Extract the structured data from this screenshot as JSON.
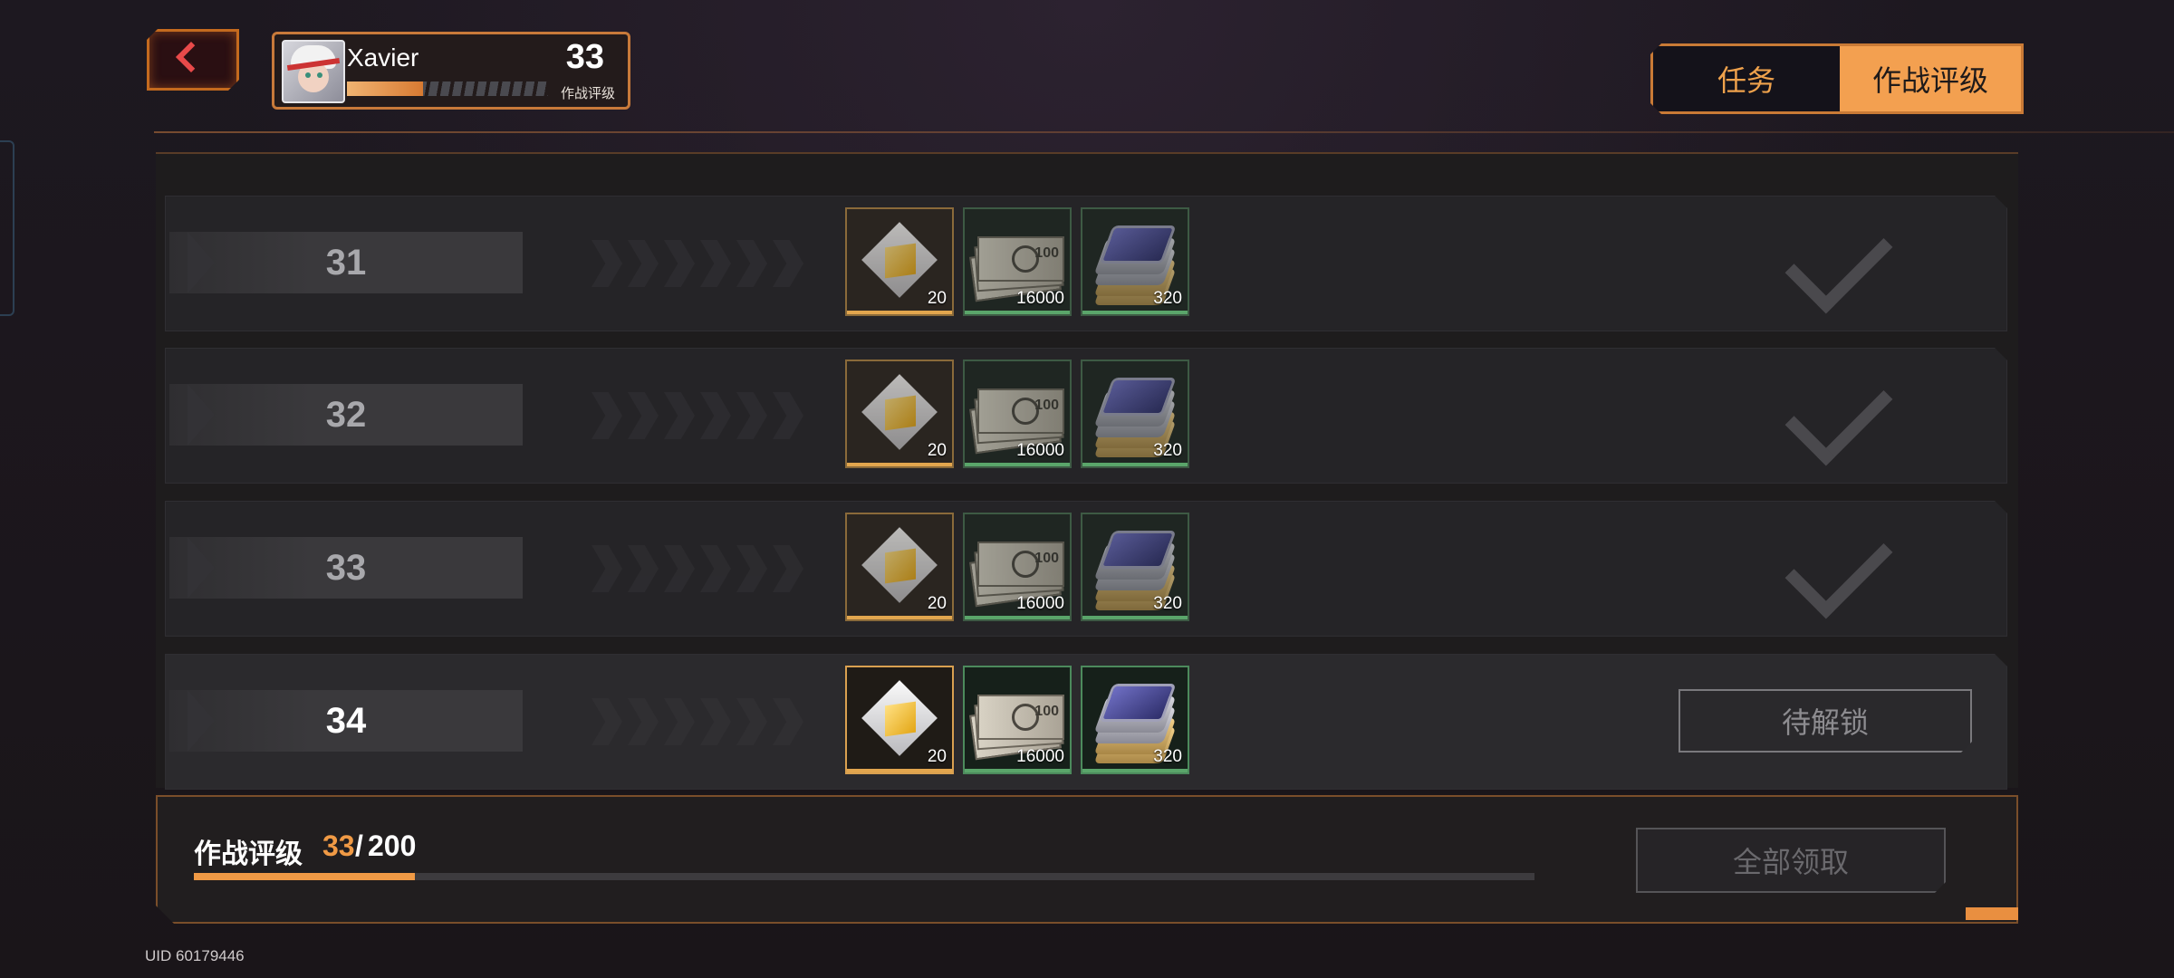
{
  "player": {
    "name": "Xavier",
    "level": "33",
    "level_label": "作战评级",
    "level_progress": 0.38
  },
  "tabs": {
    "task": "任务",
    "rank": "作战评级",
    "active": "rank"
  },
  "rows": [
    {
      "level": "31",
      "rewards": [
        {
          "icon": "cube-crystal-icon",
          "qty": "20"
        },
        {
          "icon": "banknotes-icon",
          "qty": "16000"
        },
        {
          "icon": "chip-stack-icon",
          "qty": "320"
        }
      ],
      "status": "claimed"
    },
    {
      "level": "32",
      "rewards": [
        {
          "icon": "cube-crystal-icon",
          "qty": "20"
        },
        {
          "icon": "banknotes-icon",
          "qty": "16000"
        },
        {
          "icon": "chip-stack-icon",
          "qty": "320"
        }
      ],
      "status": "claimed"
    },
    {
      "level": "33",
      "rewards": [
        {
          "icon": "cube-crystal-icon",
          "qty": "20"
        },
        {
          "icon": "banknotes-icon",
          "qty": "16000"
        },
        {
          "icon": "chip-stack-icon",
          "qty": "320"
        }
      ],
      "status": "claimed"
    },
    {
      "level": "34",
      "rewards": [
        {
          "icon": "cube-crystal-icon",
          "qty": "20"
        },
        {
          "icon": "banknotes-icon",
          "qty": "16000"
        },
        {
          "icon": "chip-stack-icon",
          "qty": "320"
        }
      ],
      "status": "locked",
      "button_label": "待解锁"
    }
  ],
  "bill_number": "100",
  "footer": {
    "rank_label": "作战评级",
    "current": "33",
    "separator": "/",
    "max": "200",
    "progress": 0.165,
    "claim_all_label": "全部领取",
    "uid": "UID 60179446"
  },
  "colors": {
    "accent": "#f09a45",
    "background": "#1c1720",
    "panel": "#252427"
  }
}
